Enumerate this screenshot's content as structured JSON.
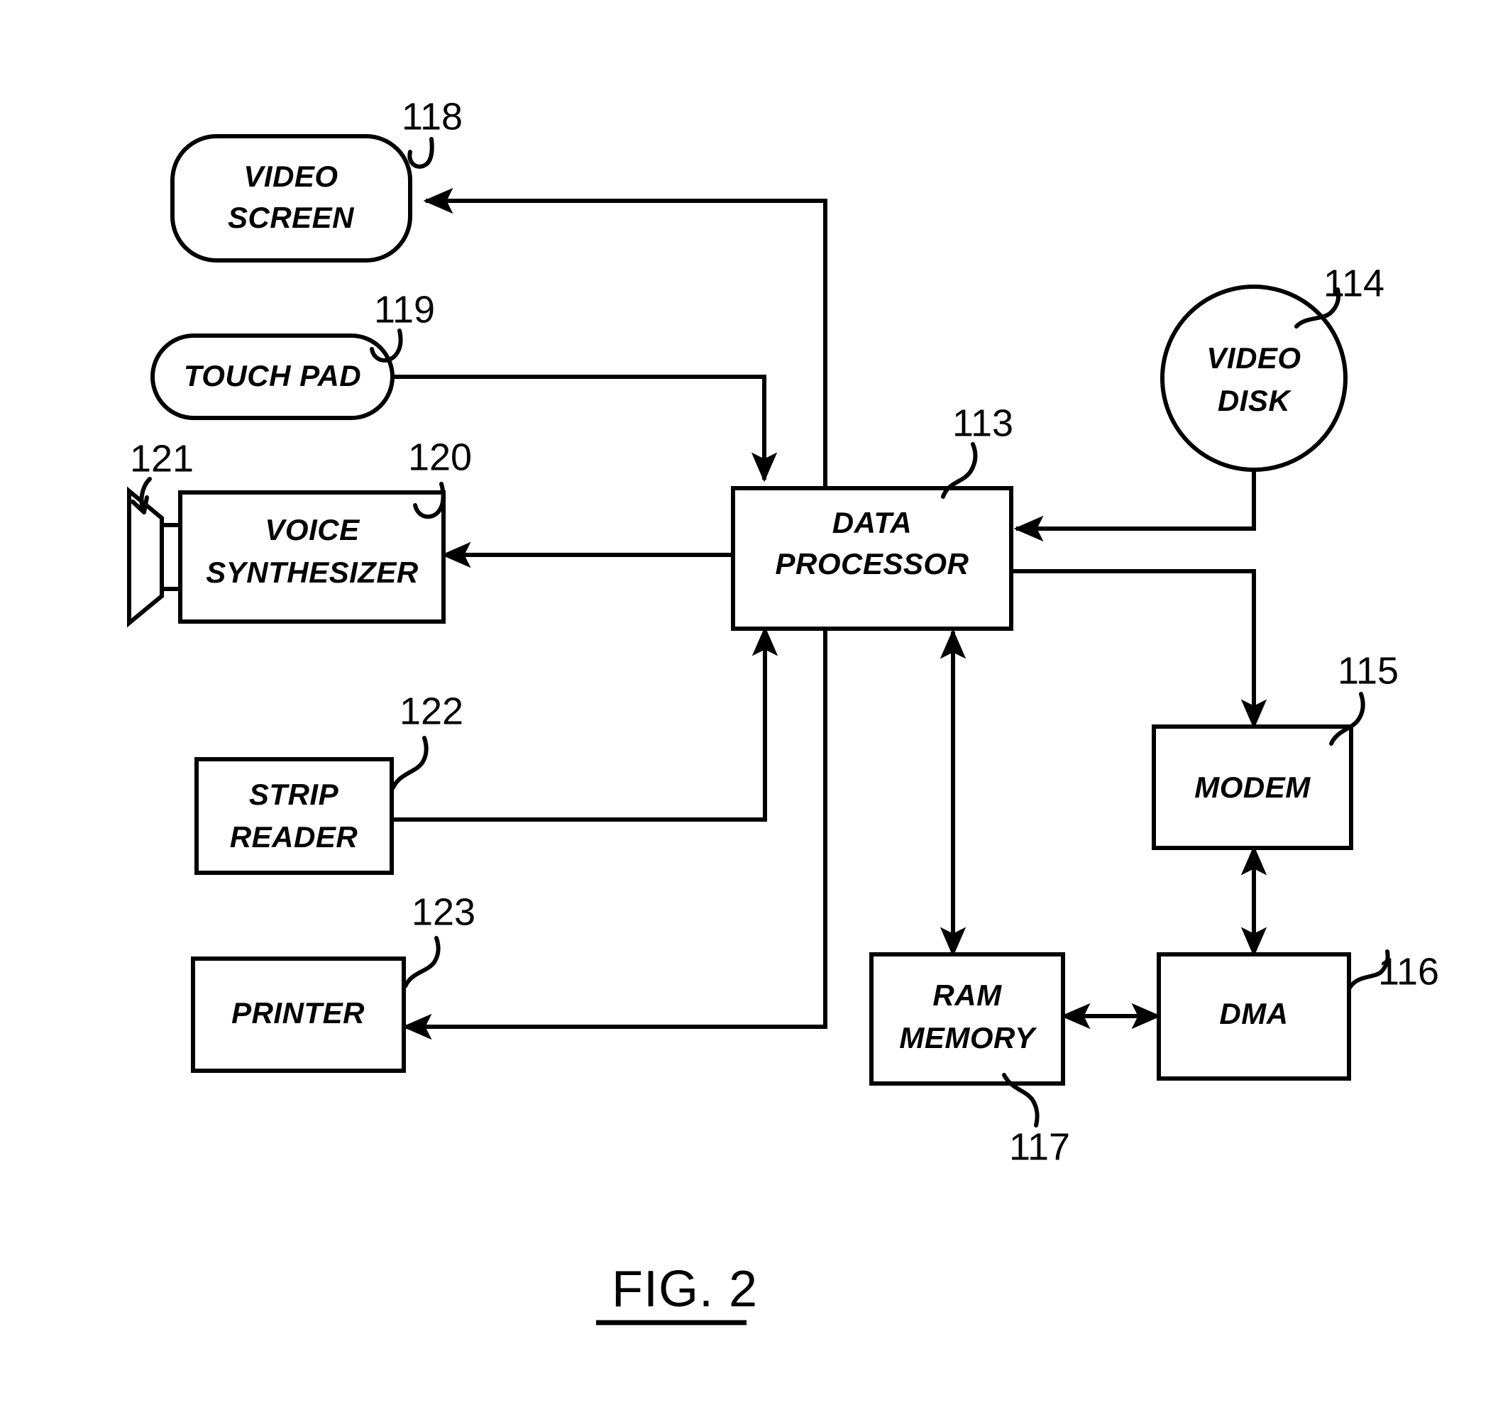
{
  "figure": {
    "caption": "FIG. 2",
    "background_color": "#ffffff",
    "line_color": "#000000"
  },
  "nodes": [
    {
      "id": "video-screen",
      "ref": "118",
      "shape": "rounded-rect",
      "lines": [
        "VIDEO",
        "SCREEN"
      ]
    },
    {
      "id": "touch-pad",
      "ref": "119",
      "shape": "stadium",
      "lines": [
        "TOUCH PAD"
      ]
    },
    {
      "id": "voice-synthesizer",
      "ref": "120",
      "shape": "rect",
      "lines": [
        "VOICE",
        "SYNTHESIZER"
      ]
    },
    {
      "id": "speaker",
      "ref": "121",
      "shape": "speaker-horn",
      "lines": []
    },
    {
      "id": "strip-reader",
      "ref": "122",
      "shape": "rect",
      "lines": [
        "STRIP",
        "READER"
      ]
    },
    {
      "id": "printer",
      "ref": "123",
      "shape": "rect",
      "lines": [
        "PRINTER"
      ]
    },
    {
      "id": "data-processor",
      "ref": "113",
      "shape": "rect",
      "lines": [
        "DATA",
        "PROCESSOR"
      ]
    },
    {
      "id": "video-disk",
      "ref": "114",
      "shape": "circle",
      "lines": [
        "VIDEO",
        "DISK"
      ]
    },
    {
      "id": "modem",
      "ref": "115",
      "shape": "rect",
      "lines": [
        "MODEM"
      ]
    },
    {
      "id": "dma",
      "ref": "116",
      "shape": "rect",
      "lines": [
        "DMA"
      ]
    },
    {
      "id": "ram-memory",
      "ref": "117",
      "shape": "rect",
      "lines": [
        "RAM",
        "MEMORY"
      ]
    }
  ],
  "node_text": {
    "video_screen_l1": "VIDEO",
    "video_screen_l2": "SCREEN",
    "touch_pad_l1": "TOUCH PAD",
    "voice_synth_l1": "VOICE",
    "voice_synth_l2": "SYNTHESIZER",
    "strip_reader_l1": "STRIP",
    "strip_reader_l2": "READER",
    "printer_l1": "PRINTER",
    "data_processor_l1": "DATA",
    "data_processor_l2": "PROCESSOR",
    "video_disk_l1": "VIDEO",
    "video_disk_l2": "DISK",
    "modem_l1": "MODEM",
    "dma_l1": "DMA",
    "ram_memory_l1": "RAM",
    "ram_memory_l2": "MEMORY"
  },
  "ref_numbers": {
    "video_screen": "118",
    "touch_pad": "119",
    "voice_synthesizer": "120",
    "speaker": "121",
    "strip_reader": "122",
    "printer": "123",
    "data_processor": "113",
    "video_disk": "114",
    "modem": "115",
    "dma": "116",
    "ram_memory": "117"
  },
  "connections": [
    {
      "id": "dp-to-video-screen",
      "from": "data-processor",
      "to": "video-screen",
      "arrows": "one-way"
    },
    {
      "id": "touch-pad-to-dp",
      "from": "touch-pad",
      "to": "data-processor",
      "arrows": "one-way"
    },
    {
      "id": "dp-to-voice-synth",
      "from": "data-processor",
      "to": "voice-synthesizer",
      "arrows": "one-way"
    },
    {
      "id": "strip-reader-to-dp",
      "from": "strip-reader",
      "to": "data-processor",
      "arrows": "one-way"
    },
    {
      "id": "dp-to-printer",
      "from": "data-processor",
      "to": "printer",
      "arrows": "one-way"
    },
    {
      "id": "video-disk-to-dp",
      "from": "video-disk",
      "to": "data-processor",
      "arrows": "one-way"
    },
    {
      "id": "dp-to-modem",
      "from": "data-processor",
      "to": "modem",
      "arrows": "one-way"
    },
    {
      "id": "dp-to-ram",
      "from": "data-processor",
      "to": "ram-memory",
      "arrows": "two-way"
    },
    {
      "id": "modem-to-dma",
      "from": "modem",
      "to": "dma",
      "arrows": "two-way"
    },
    {
      "id": "ram-to-dma",
      "from": "ram-memory",
      "to": "dma",
      "arrows": "two-way"
    }
  ]
}
